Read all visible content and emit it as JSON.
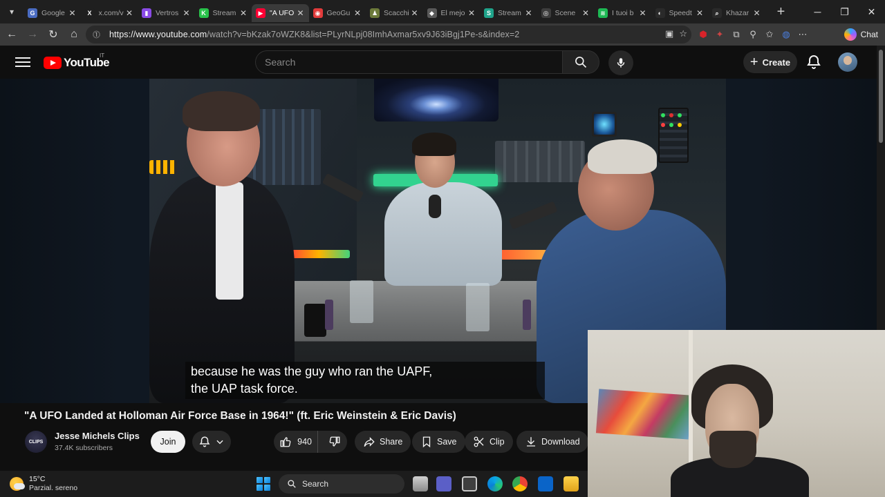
{
  "browser": {
    "tabs": [
      {
        "title": "Google",
        "favicon": "google-docs-icon",
        "color": "#4a6cc2",
        "glyph": "G"
      },
      {
        "title": "x.com/v",
        "favicon": "x-icon",
        "color": "#1f1f1f",
        "glyph": "X"
      },
      {
        "title": "Vertros",
        "favicon": "twitch-icon",
        "color": "#8a4be6",
        "glyph": "▮"
      },
      {
        "title": "Stream",
        "favicon": "kick-icon",
        "color": "#28c24a",
        "glyph": "K"
      },
      {
        "title": "\"A UFO",
        "favicon": "youtube-icon",
        "color": "#ff0033",
        "glyph": "▶",
        "active": true
      },
      {
        "title": "GeoGu",
        "favicon": "geoguessr-icon",
        "color": "#e23b3b",
        "glyph": "◉"
      },
      {
        "title": "Scacchi",
        "favicon": "chess-icon",
        "color": "#6c7a3a",
        "glyph": "♟"
      },
      {
        "title": "El mejo",
        "favicon": "web-icon",
        "color": "#5a5a5a",
        "glyph": "◆"
      },
      {
        "title": "Stream",
        "favicon": "streamlabs-icon",
        "color": "#1fa38a",
        "glyph": "S"
      },
      {
        "title": "Scene",
        "favicon": "obs-icon",
        "color": "#3d3d3d",
        "glyph": "◎"
      },
      {
        "title": "I tuoi b",
        "favicon": "spotify-icon",
        "color": "#1db954",
        "glyph": "≋"
      },
      {
        "title": "Speedt",
        "favicon": "github-icon",
        "color": "#2a2a2a",
        "glyph": "◐"
      },
      {
        "title": "Khazar",
        "favicon": "search-icon",
        "color": "#2a2a2a",
        "glyph": "⌕"
      }
    ],
    "url_host": "https://www.youtube.com",
    "url_path": "/watch?v=bKzak7oWZK8&list=PLyrNLpj08ImhAxmar5xv9J63iBgj1Pe-s&index=2",
    "chat_label": "Chat"
  },
  "youtube": {
    "logo_text": "YouTube",
    "country_code": "IT",
    "search_placeholder": "Search",
    "create_label": "Create"
  },
  "video": {
    "caption_line1": "because he was the guy who ran the UAPF,",
    "caption_line2": "the UAP task force.",
    "title": "\"A UFO Landed at Holloman Air Force Base in 1964!\" (ft. Eric Weinstein & Eric Davis)",
    "channel_name": "Jesse Michels Clips",
    "channel_logo_text": "CLIPS",
    "subscribers": "37.4K subscribers",
    "join_label": "Join",
    "likes": "940",
    "share_label": "Share",
    "save_label": "Save",
    "clip_label": "Clip",
    "download_label": "Download"
  },
  "taskbar": {
    "temperature": "15°C",
    "weather_desc": "Parzial. sereno",
    "search_label": "Search"
  }
}
